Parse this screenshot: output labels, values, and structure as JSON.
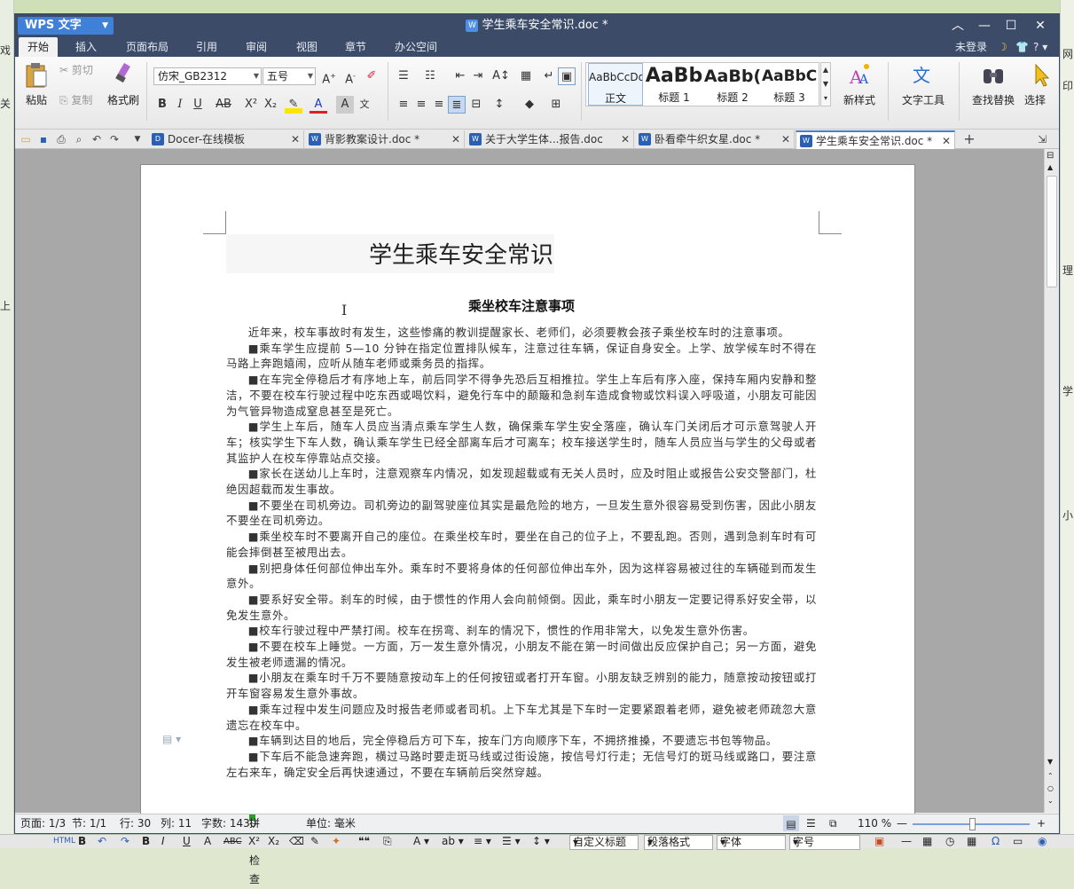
{
  "app": {
    "name": "WPS 文字",
    "doc_title": "学生乘车安全常识.doc *"
  },
  "menu": {
    "items": [
      "开始",
      "插入",
      "页面布局",
      "引用",
      "审阅",
      "视图",
      "章节",
      "办公空间"
    ],
    "login": "未登录",
    "help": "?"
  },
  "ribbon": {
    "paste": "粘贴",
    "cut": "剪切",
    "copy": "复制",
    "format_painter": "格式刷",
    "font_name": "仿宋_GB2312",
    "font_size": "五号",
    "styles": [
      {
        "preview": "AaBbCcDd",
        "label": "正文"
      },
      {
        "preview": "AaBb",
        "label": "标题 1"
      },
      {
        "preview": "AaBb(",
        "label": "标题 2"
      },
      {
        "preview": "AaBbC(",
        "label": "标题 3"
      }
    ],
    "new_style": "新样式",
    "text_tools": "文字工具",
    "find_replace": "查找替换",
    "select": "选择"
  },
  "tabs": [
    {
      "label": "Docer-在线模板",
      "icon": "docer"
    },
    {
      "label": "背影教案设计.doc *",
      "icon": "word"
    },
    {
      "label": "关于大学生体...报告.doc",
      "icon": "word"
    },
    {
      "label": "卧看牵牛织女星.doc *",
      "icon": "word"
    },
    {
      "label": "学生乘车安全常识.doc *",
      "icon": "word",
      "active": true
    }
  ],
  "document": {
    "title": "学生乘车安全常识",
    "subtitle": "乘坐校车注意事项",
    "paragraphs": [
      "近年来，校车事故时有发生，这些惨痛的教训提醒家长、老师们，必须要教会孩子乘坐校车时的注意事项。",
      "■乘车学生应提前 5—10 分钟在指定位置排队候车，注意过往车辆，保证自身安全。上学、放学候车时不得在马路上奔跑嬉闹，应听从随车老师或乘务员的指挥。",
      "■在车完全停稳后才有序地上车，前后同学不得争先恐后互相推拉。学生上车后有序入座，保持车厢内安静和整洁，不要在校车行驶过程中吃东西或喝饮料，避免行车中的颠簸和急刹车造成食物或饮料误入呼吸道，小朋友可能因为气管异物造成窒息甚至是死亡。",
      "■学生上车后，随车人员应当清点乘车学生人数，确保乘车学生安全落座，确认车门关闭后才可示意驾驶人开车；核实学生下车人数，确认乘车学生已经全部离车后才可离车；校车接送学生时，随车人员应当与学生的父母或者其监护人在校车停靠站点交接。",
      "■家长在送幼儿上车时，注意观察车内情况，如发现超载或有无关人员时，应及时阻止或报告公安交警部门，杜绝因超载而发生事故。",
      "■不要坐在司机旁边。司机旁边的副驾驶座位其实是最危险的地方，一旦发生意外很容易受到伤害，因此小朋友不要坐在司机旁边。",
      "■乘坐校车时不要离开自己的座位。在乘坐校车时，要坐在自己的位子上，不要乱跑。否则，遇到急刹车时有可能会摔倒甚至被甩出去。",
      "■别把身体任何部位伸出车外。乘车时不要将身体的任何部位伸出车外，因为这样容易被过往的车辆碰到而发生意外。",
      "■要系好安全带。刹车的时候，由于惯性的作用人会向前倾倒。因此，乘车时小朋友一定要记得系好安全带，以免发生意外。",
      "■校车行驶过程中严禁打闹。校车在拐弯、刹车的情况下，惯性的作用非常大，以免发生意外伤害。",
      "■不要在校车上睡觉。一方面，万一发生意外情况，小朋友不能在第一时间做出反应保护自己；另一方面，避免发生被老师遗漏的情况。",
      "■小朋友在乘车时千万不要随意按动车上的任何按钮或者打开车窗。小朋友缺乏辨别的能力，随意按动按钮或打开车窗容易发生意外事故。",
      "■乘车过程中发生问题应及时报告老师或者司机。上下车尤其是下车时一定要紧跟着老师，避免被老师疏忽大意遗忘在校车中。",
      "■车辆到达目的地后，完全停稳后方可下车，按车门方向顺序下车，不拥挤推搡，不要遗忘书包等物品。",
      "■下车后不能急速奔跑，横过马路时要走斑马线或过街设施，按信号灯行走；无信号灯的斑马线或路口，要注意左右来车，确定安全后再快速通过，不要在车辆前后突然穿越。"
    ]
  },
  "status": {
    "page": "页面: 1/3",
    "section": "节: 1/1",
    "row": "行: 30",
    "col": "列: 11",
    "words": "字数: 1430",
    "spell": "拼写检查",
    "unit": "单位: 毫米",
    "zoom": "110 %"
  },
  "bottom": {
    "custom_heading": "自定义标题",
    "para_format": "段落格式",
    "font": "字体",
    "size": "字号"
  },
  "colors": {
    "title_bar": "#3c4b67",
    "wps_button": "#3f80d9",
    "workspace": "#a8a8a8"
  }
}
